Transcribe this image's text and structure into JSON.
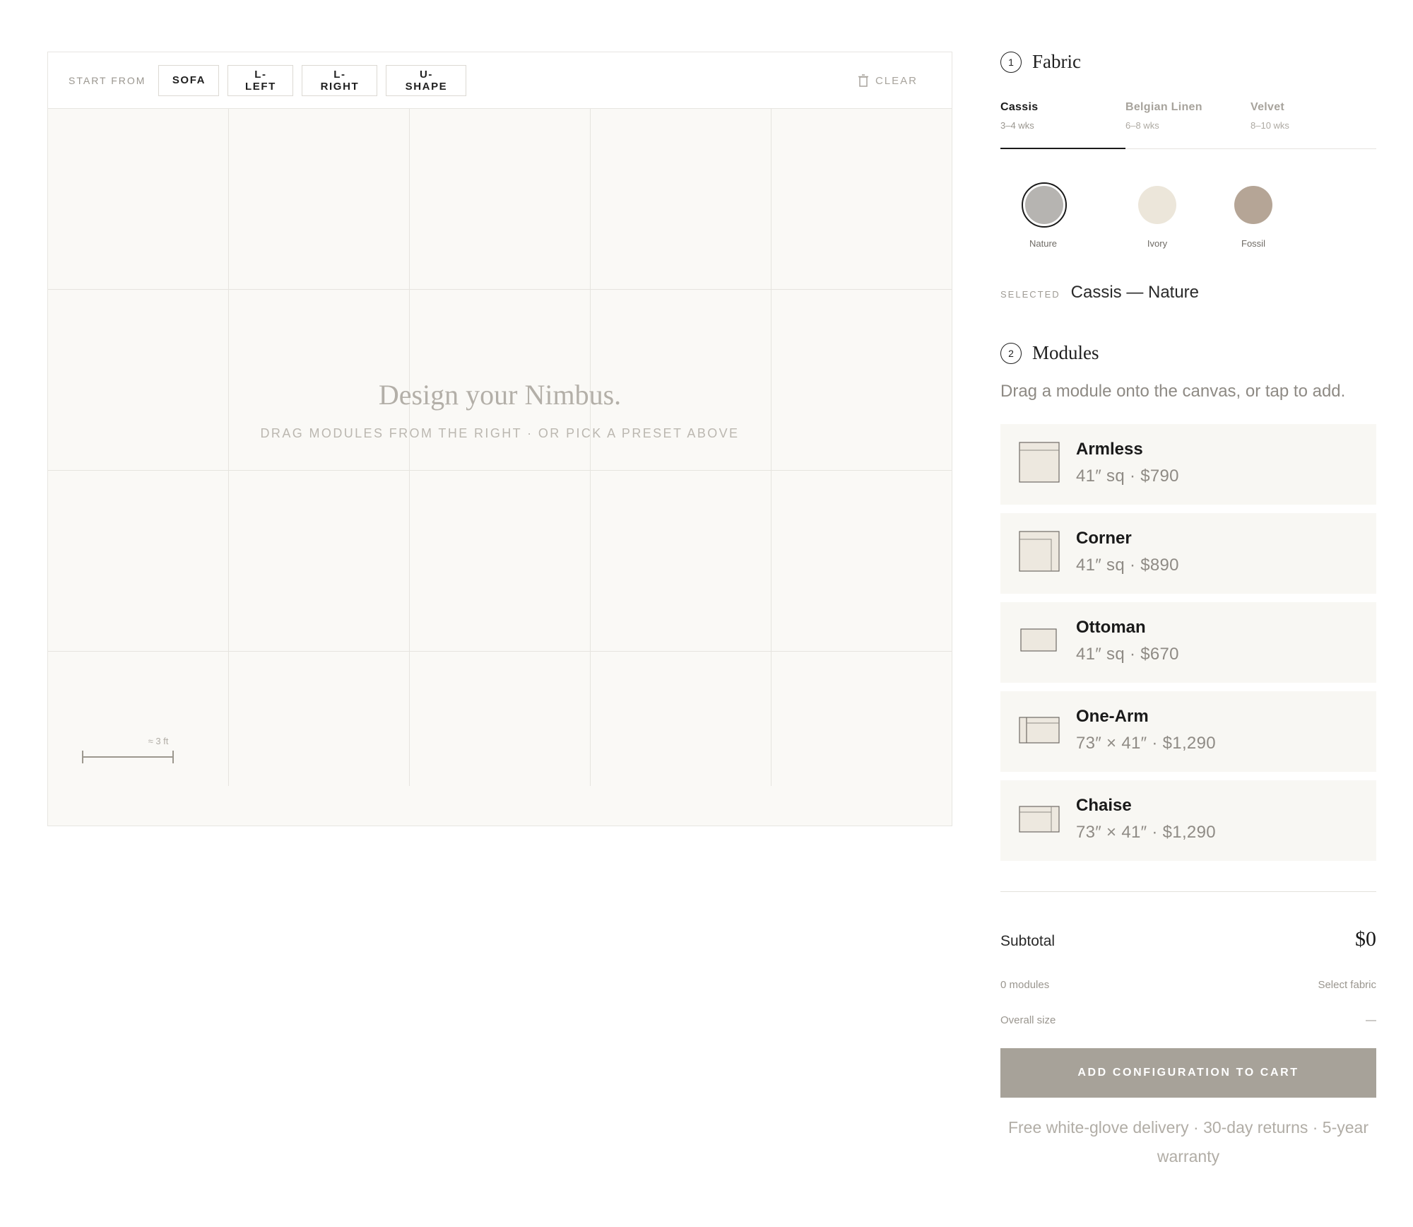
{
  "canvas": {
    "start_label": "START FROM",
    "presets": [
      "SOFA",
      "L-LEFT",
      "L-RIGHT",
      "U-SHAPE"
    ],
    "clear_label": "CLEAR",
    "empty_title": "Design your Nimbus.",
    "empty_subtitle": "DRAG MODULES FROM THE RIGHT · OR PICK A PRESET ABOVE",
    "scale_label": "≈ 3 ft"
  },
  "fabric": {
    "step": "1",
    "title": "Fabric",
    "tabs": [
      {
        "name": "Cassis",
        "lead": "3–4 wks",
        "active": true
      },
      {
        "name": "Belgian Linen",
        "lead": "6–8 wks",
        "active": false
      },
      {
        "name": "Velvet",
        "lead": "8–10 wks",
        "active": false
      }
    ],
    "swatches": [
      {
        "name": "Nature",
        "color": "#b6b4b1",
        "selected": true
      },
      {
        "name": "Ivory",
        "color": "#ece6da",
        "selected": false
      },
      {
        "name": "Fossil",
        "color": "#b5a596",
        "selected": false
      }
    ],
    "selected_tag": "SELECTED",
    "selected_value": "Cassis — Nature"
  },
  "modules": {
    "step": "2",
    "title": "Modules",
    "hint": "Drag a module onto the canvas, or tap to add.",
    "items": [
      {
        "name": "Armless",
        "meta": "41″ sq · $790",
        "icon": "armless-module-icon"
      },
      {
        "name": "Corner",
        "meta": "41″ sq · $890",
        "icon": "corner-module-icon"
      },
      {
        "name": "Ottoman",
        "meta": "41″ sq · $670",
        "icon": "ottoman-module-icon"
      },
      {
        "name": "One-Arm",
        "meta": "73″ × 41″ · $1,290",
        "icon": "one-arm-module-icon"
      },
      {
        "name": "Chaise",
        "meta": "73″ × 41″ · $1,290",
        "icon": "chaise-module-icon"
      }
    ]
  },
  "summary": {
    "subtotal_label": "Subtotal",
    "subtotal_value": "$0",
    "modules_count": "0 modules",
    "fabric_status": "Select fabric",
    "size_label": "Overall size",
    "size_value": "—",
    "cart_button": "ADD CONFIGURATION TO CART",
    "footnote": "Free white-glove delivery · 30-day returns · 5-year warranty"
  },
  "colors": {
    "accent": "#1a1a1a",
    "canvas_bg": "#faf9f6",
    "card_bg": "#f8f7f3",
    "cart_button_bg": "#a7a299",
    "module_fill": "#ede8df"
  }
}
